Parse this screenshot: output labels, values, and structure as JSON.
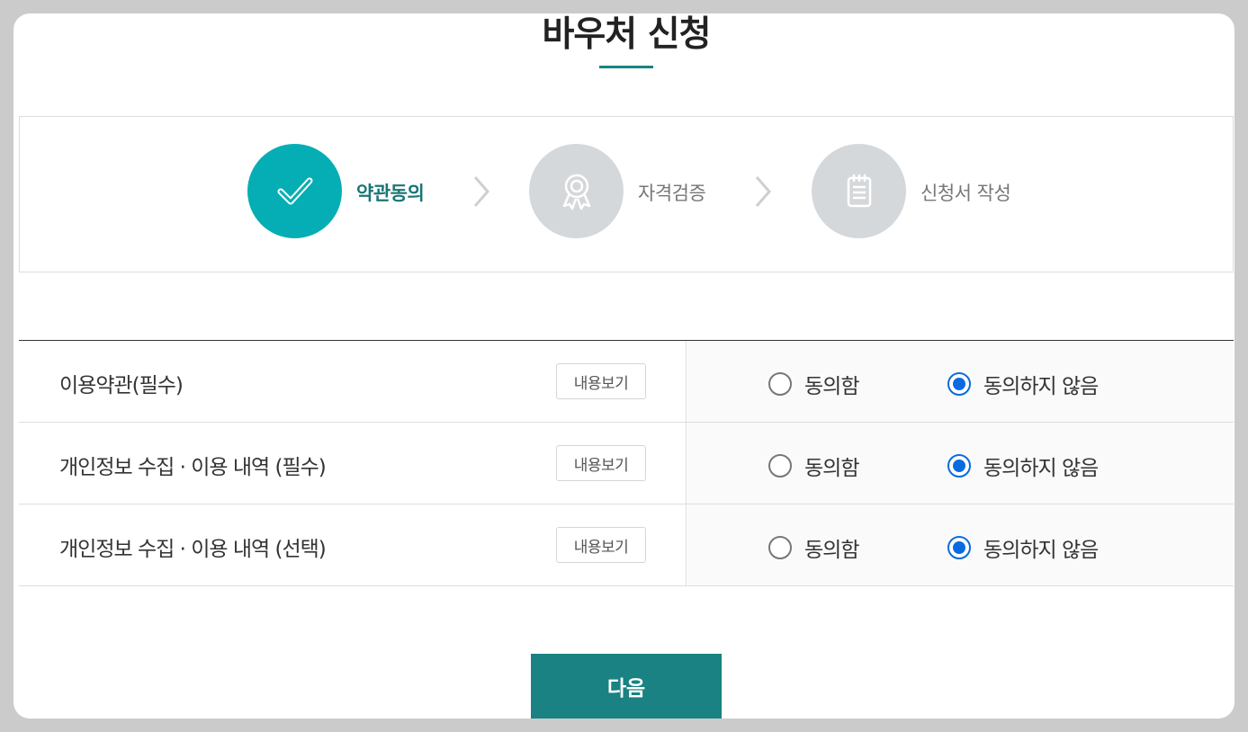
{
  "header": {
    "title": "바우처 신청"
  },
  "steps": [
    {
      "label": "약관동의",
      "icon": "check-icon",
      "state": "active"
    },
    {
      "label": "자격검증",
      "icon": "award-icon",
      "state": "inactive"
    },
    {
      "label": "신청서 작성",
      "icon": "document-icon",
      "state": "inactive"
    }
  ],
  "agreements": [
    {
      "title": "이용약관(필수)",
      "view_label": "내용보기",
      "agree_label": "동의함",
      "disagree_label": "동의하지 않음",
      "selected": "disagree"
    },
    {
      "title": "개인정보 수집 · 이용 내역 (필수)",
      "view_label": "내용보기",
      "agree_label": "동의함",
      "disagree_label": "동의하지 않음",
      "selected": "disagree"
    },
    {
      "title": "개인정보 수집 · 이용 내역 (선택)",
      "view_label": "내용보기",
      "agree_label": "동의함",
      "disagree_label": "동의하지 않음",
      "selected": "disagree"
    }
  ],
  "footer": {
    "next_label": "다음"
  },
  "colors": {
    "accent": "#1a8282",
    "step_active": "#04aeb4",
    "step_inactive": "#d5d8db",
    "radio_checked": "#0a6be0"
  }
}
